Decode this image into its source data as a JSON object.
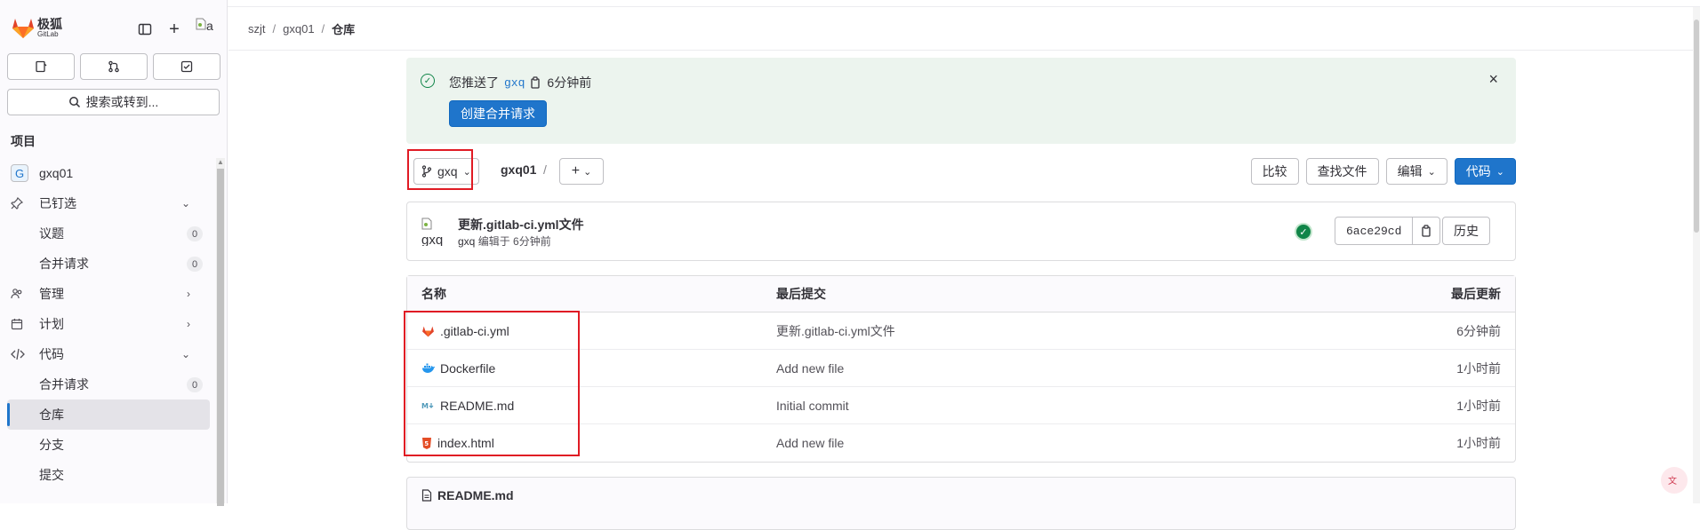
{
  "app": {
    "logo_cn": "极狐",
    "logo_en": "GitLab",
    "avatar_alt": "a"
  },
  "sidebar": {
    "search_label": "搜索或转到...",
    "section_title": "项目",
    "project": {
      "badge": "G",
      "name": "gxq01"
    },
    "items": [
      {
        "label": "已钉选",
        "icon": "pin-icon",
        "chevron": "down"
      },
      {
        "label": "议题",
        "count": "0"
      },
      {
        "label": "合并请求",
        "count": "0"
      },
      {
        "label": "管理",
        "icon": "users-icon",
        "chevron": "right"
      },
      {
        "label": "计划",
        "icon": "calendar-icon",
        "chevron": "right"
      },
      {
        "label": "代码",
        "icon": "code-icon",
        "chevron": "down"
      },
      {
        "label": "合并请求",
        "count": "0"
      },
      {
        "label": "仓库",
        "active": true
      },
      {
        "label": "分支"
      },
      {
        "label": "提交"
      }
    ]
  },
  "breadcrumb": {
    "items": [
      "szjt",
      "gxq01",
      "仓库"
    ],
    "separator": "/"
  },
  "alert": {
    "prefix": "您推送了",
    "branch": "gxq",
    "time": "6分钟前",
    "button": "创建合并请求",
    "close": "×"
  },
  "toolbar": {
    "branch": "gxq",
    "repo_path": "gxq01",
    "path_sep": "/",
    "add": "+",
    "compare": "比较",
    "find_file": "查找文件",
    "edit": "编辑",
    "code": "代码"
  },
  "last_commit": {
    "avatar_alt": "gxq",
    "title": "更新.gitlab-ci.yml文件",
    "author": "gxq",
    "meta": "编辑于 6分钟前",
    "sha": "6ace29cd",
    "history": "历史",
    "pipeline_status": "passed"
  },
  "files": {
    "headers": {
      "name": "名称",
      "commit": "最后提交",
      "date": "最后更新"
    },
    "rows": [
      {
        "name": ".gitlab-ci.yml",
        "icon": "gitlab-icon",
        "commit": "更新.gitlab-ci.yml文件",
        "date": "6分钟前"
      },
      {
        "name": "Dockerfile",
        "icon": "docker-icon",
        "commit": "Add new file",
        "date": "1小时前"
      },
      {
        "name": "README.md",
        "icon": "markdown-icon",
        "commit": "Initial commit",
        "date": "1小时前"
      },
      {
        "name": "index.html",
        "icon": "html5-icon",
        "commit": "Add new file",
        "date": "1小时前"
      }
    ]
  },
  "readme": {
    "title": "README.md"
  },
  "colors": {
    "accent": "#1f75cb",
    "success": "#108548",
    "alert_bg": "#ecf4ee",
    "annotation": "#e01b24",
    "logo": "#e24329"
  }
}
